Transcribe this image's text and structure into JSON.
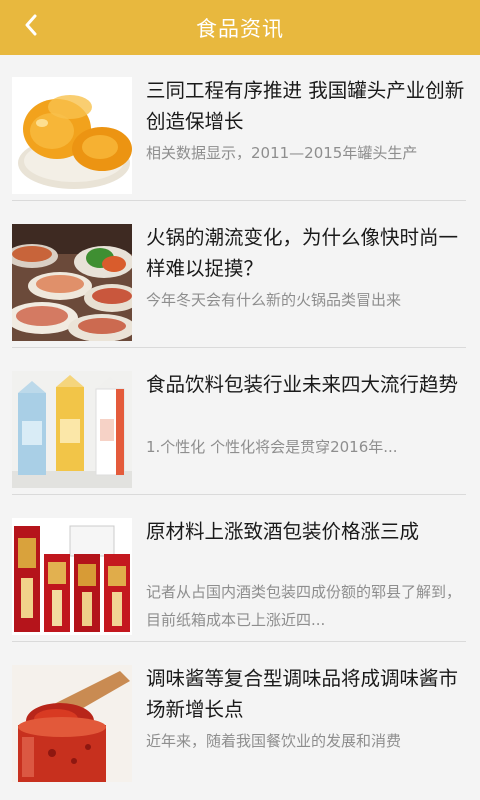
{
  "header": {
    "title": "食品资讯",
    "back_icon": "chevron-left-icon"
  },
  "colors": {
    "header_bg": "#e8b83e",
    "title_text": "#1a1a1a",
    "desc_text": "#8e8e8e"
  },
  "articles": [
    {
      "title": "三同工程有序推进 我国罐头产业创新创造保增长",
      "desc": "相关数据显示，2011—2015年罐头生产",
      "image": "canned-peaches-image"
    },
    {
      "title": "火锅的潮流变化，为什么像快时尚一样难以捉摸？",
      "desc": "今年冬天会有什么新的火锅品类冒出来",
      "image": "hotpot-dishes-image"
    },
    {
      "title": "食品饮料包装行业未来四大流行趋势",
      "desc": "1.个性化 个性化将会是贯穿2016年...",
      "image": "drink-cartons-image"
    },
    {
      "title": "原材料上涨致酒包装价格涨三成",
      "desc": "记者从占国内酒类包装四成份额的郓县了解到，目前纸箱成本已上涨近四...",
      "image": "liquor-boxes-image"
    },
    {
      "title": "调味酱等复合型调味品将成调味酱市场新增长点",
      "desc": "近年来，随着我国餐饮业的发展和消费",
      "image": "chili-sauce-jar-image"
    }
  ]
}
